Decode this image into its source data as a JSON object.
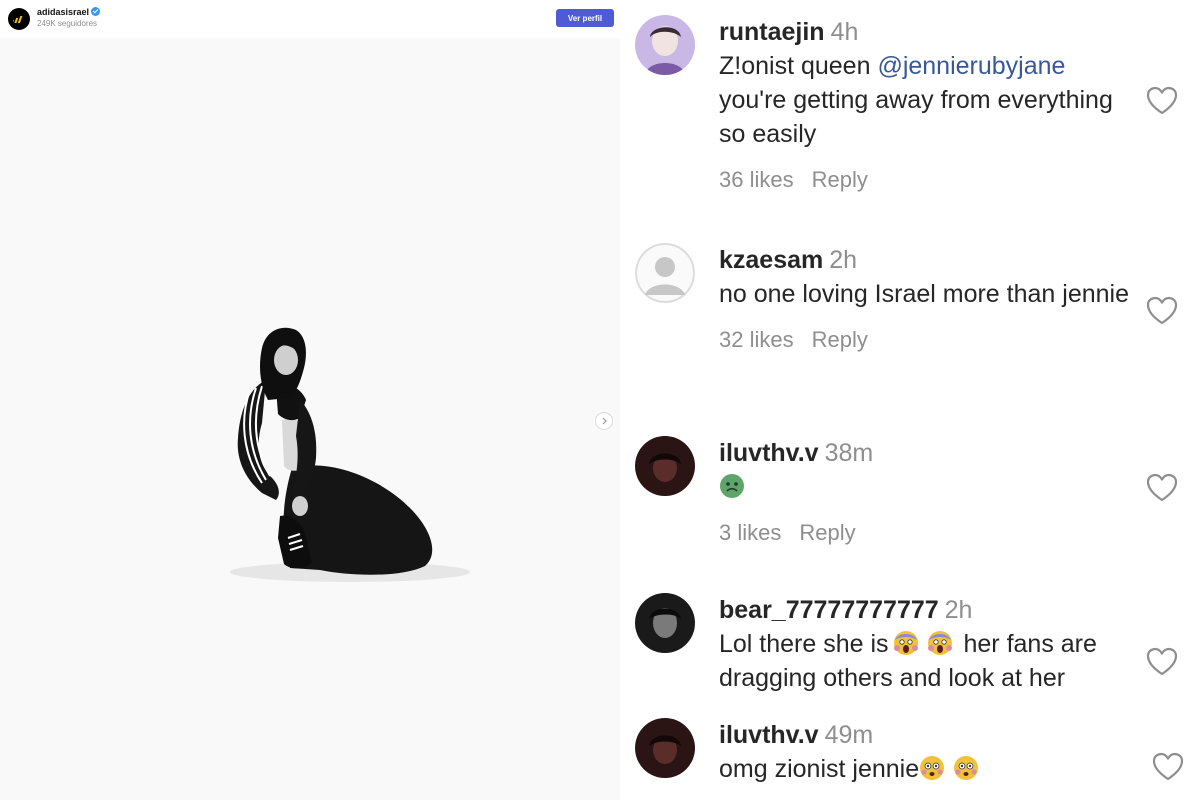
{
  "embed": {
    "username": "adidasisrael",
    "followers": "249K seguidores",
    "view_profile": "Ver perfil"
  },
  "comments": [
    {
      "username": "runtaejin",
      "time": "4h",
      "text_prefix": "Z!onist queen ",
      "mention": "@jennierubyjane",
      "text_suffix": "you're getting away from everything so easily",
      "likes": "36 likes",
      "reply": "Reply"
    },
    {
      "username": "kzaesam",
      "time": "2h",
      "text": "no one loving Israel more than jennie",
      "likes": "32 likes",
      "reply": "Reply"
    },
    {
      "username": "iluvthv.v",
      "time": "38m",
      "emoji": "nauseated-face",
      "likes": "3 likes",
      "reply": "Reply"
    },
    {
      "username": "bear_77777777777",
      "time": "2h",
      "text_prefix": "Lol there she is",
      "text_suffix": "her fans are dragging others and look at her",
      "emojis": [
        "screaming-face",
        "screaming-face"
      ]
    },
    {
      "username": "iluvthv.v",
      "time": "49m",
      "text": "omg zionist jennie",
      "emojis": [
        "flushed-face",
        "flushed-face"
      ]
    }
  ],
  "colors": {
    "accent": "#4f5bd5",
    "mention": "#385898",
    "muted": "#8e8e8e",
    "text": "#262626"
  }
}
